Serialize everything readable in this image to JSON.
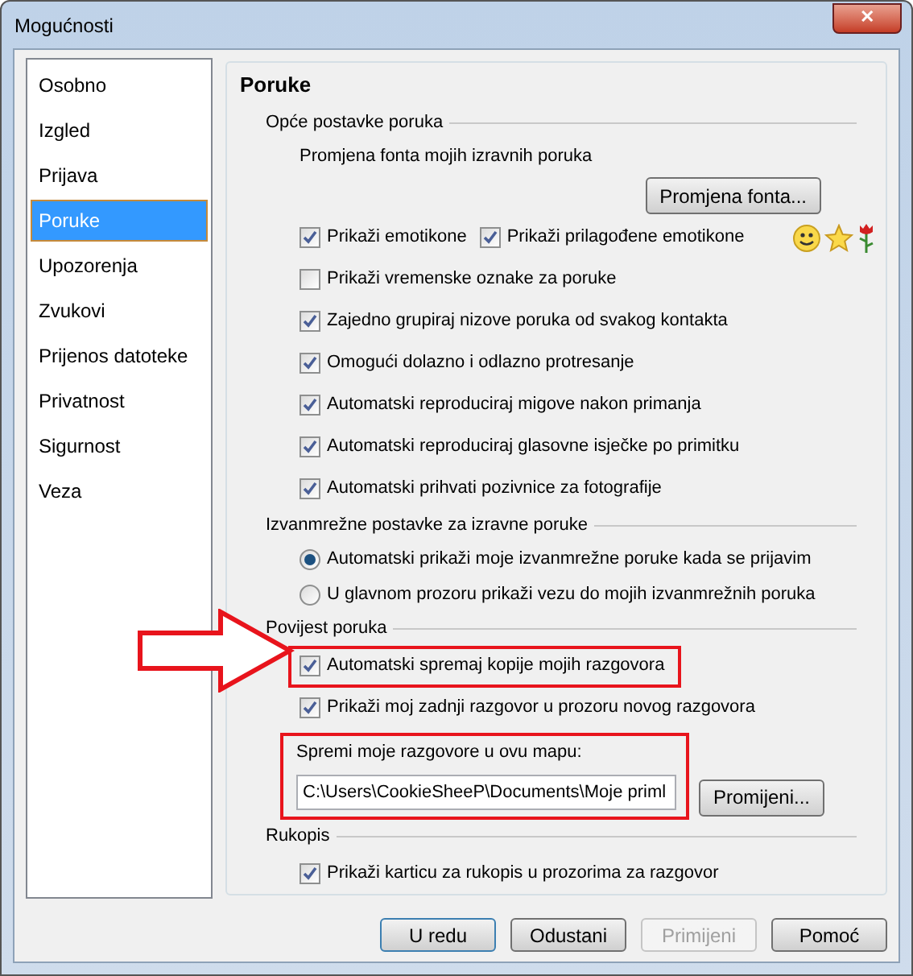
{
  "window": {
    "title": "Mogućnosti",
    "close_label": "✕"
  },
  "sidebar": {
    "items": [
      {
        "label": "Osobno",
        "selected": false
      },
      {
        "label": "Izgled",
        "selected": false
      },
      {
        "label": "Prijava",
        "selected": false
      },
      {
        "label": "Poruke",
        "selected": true
      },
      {
        "label": "Upozorenja",
        "selected": false
      },
      {
        "label": "Zvukovi",
        "selected": false
      },
      {
        "label": "Prijenos datoteke",
        "selected": false
      },
      {
        "label": "Privatnost",
        "selected": false
      },
      {
        "label": "Sigurnost",
        "selected": false
      },
      {
        "label": "Veza",
        "selected": false
      }
    ]
  },
  "panel": {
    "title": "Poruke",
    "sections": [
      {
        "heading": "Opće postavke poruka",
        "items": [
          {
            "kind": "text",
            "label": "Promjena fonta mojih izravnih poruka"
          },
          {
            "kind": "button",
            "label": "Promjena fonta..."
          },
          {
            "kind": "checkbox_pair",
            "emoticons": true,
            "items": [
              {
                "label": "Prikaži emotikone",
                "checked": true
              },
              {
                "label": "Prikaži prilagođene emotikone",
                "checked": true
              }
            ]
          },
          {
            "kind": "checkbox",
            "label": "Prikaži vremenske oznake za poruke",
            "checked": false,
            "highlighted": false
          },
          {
            "kind": "checkbox",
            "label": "Zajedno grupiraj nizove poruka od svakog kontakta",
            "checked": true,
            "highlighted": false
          },
          {
            "kind": "checkbox",
            "label": "Omogući dolazno i odlazno protresanje",
            "checked": true,
            "highlighted": false
          },
          {
            "kind": "checkbox",
            "label": "Automatski reproduciraj migove nakon primanja",
            "checked": true,
            "highlighted": false
          },
          {
            "kind": "checkbox",
            "label": "Automatski reproduciraj glasovne isječke po primitku",
            "checked": true,
            "highlighted": false
          },
          {
            "kind": "checkbox",
            "label": "Automatski prihvati pozivnice za fotografije",
            "checked": true,
            "highlighted": false
          }
        ]
      },
      {
        "heading": "Izvanmrežne postavke za izravne poruke",
        "items": [
          {
            "kind": "radio",
            "label": "Automatski prikaži moje izvanmrežne poruke kada se prijavim",
            "selected": true
          },
          {
            "kind": "radio",
            "label": "U glavnom prozoru prikaži vezu do mojih izvanmrežnih poruka",
            "selected": false
          }
        ]
      },
      {
        "heading": "Povijest poruka",
        "items": [
          {
            "kind": "checkbox",
            "label": "Automatski spremaj kopije mojih razgovora",
            "checked": true,
            "highlighted": true
          },
          {
            "kind": "checkbox",
            "label": "Prikaži moj zadnji razgovor u prozoru novog razgovora",
            "checked": true,
            "highlighted": false
          },
          {
            "kind": "folder",
            "label": "Spremi moje razgovore u ovu mapu:",
            "value": "C:\\Users\\CookieSheeP\\Documents\\Moje priml",
            "button": "Promijeni...",
            "highlighted": true
          }
        ]
      },
      {
        "heading": "Rukopis",
        "items": [
          {
            "kind": "checkbox",
            "label": "Prikaži karticu za rukopis u prozorima za razgovor",
            "checked": true,
            "highlighted": false
          }
        ]
      }
    ]
  },
  "buttons": [
    {
      "label": "U redu",
      "default": true,
      "disabled": false
    },
    {
      "label": "Odustani",
      "default": false,
      "disabled": false
    },
    {
      "label": "Primijeni",
      "default": false,
      "disabled": true
    },
    {
      "label": "Pomoć",
      "default": false,
      "disabled": false
    }
  ]
}
